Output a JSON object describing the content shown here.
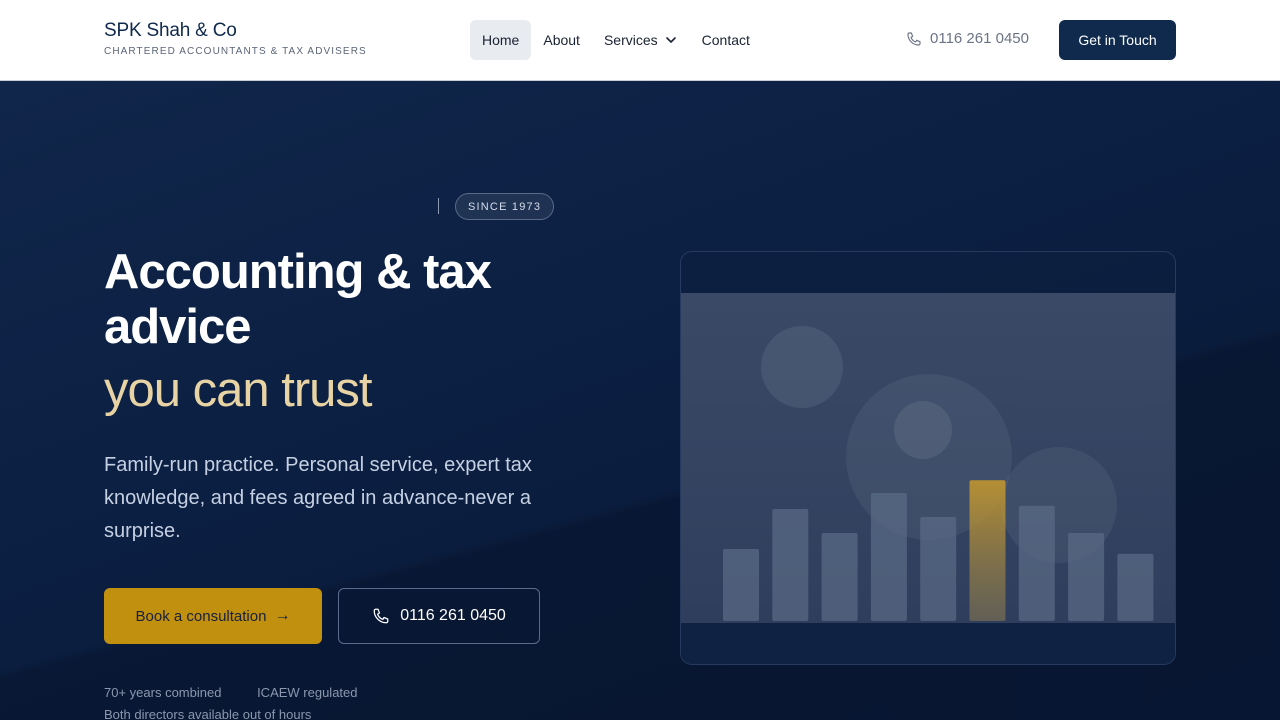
{
  "header": {
    "brand_name": "SPK Shah & Co",
    "brand_tagline": "CHARTERED ACCOUNTANTS & TAX ADVISERS",
    "nav": [
      {
        "label": "Home",
        "active": true
      },
      {
        "label": "About"
      },
      {
        "label": "Services",
        "has_dropdown": true
      },
      {
        "label": "Contact"
      }
    ],
    "phone": "0116 261 0450",
    "cta_label": "Get in Touch"
  },
  "hero": {
    "badge": "SINCE 1973",
    "headline": "Accounting & tax advice",
    "headline_accent": "you can trust",
    "lead": "Family-run practice. Personal service, expert tax knowledge, and fees agreed in advance-never a surprise.",
    "primary_button": "Book a consultation",
    "secondary_button": "0116 261 0450",
    "trust_items": [
      "70+ years combined",
      "ICAEW regulated"
    ],
    "trust_line2": "Both directors available out of hours"
  },
  "illustration": {
    "bar_levels": [
      0.45,
      0.7,
      0.55,
      0.8,
      0.65,
      0.88,
      0.72,
      0.55,
      0.42
    ],
    "highlight_index": 5
  },
  "colors": {
    "navy": "#0f2a4d",
    "gold": "#c2900f",
    "accent_text": "#e8d3a4",
    "hero_bg": "#0c1f40"
  }
}
